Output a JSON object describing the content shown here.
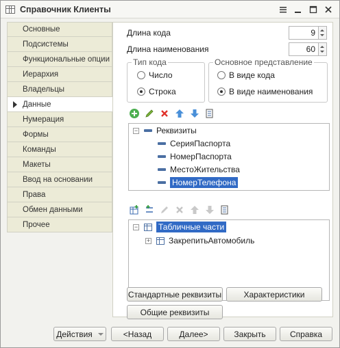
{
  "window": {
    "title": "Справочник Клиенты"
  },
  "sidebar": {
    "items": [
      {
        "label": "Основные"
      },
      {
        "label": "Подсистемы"
      },
      {
        "label": "Функциональные опции"
      },
      {
        "label": "Иерархия"
      },
      {
        "label": "Владельцы"
      },
      {
        "label": "Данные",
        "active": true
      },
      {
        "label": "Нумерация"
      },
      {
        "label": "Формы"
      },
      {
        "label": "Команды"
      },
      {
        "label": "Макеты"
      },
      {
        "label": "Ввод на основании"
      },
      {
        "label": "Права"
      },
      {
        "label": "Обмен данными"
      },
      {
        "label": "Прочее"
      }
    ]
  },
  "fields": {
    "code_length_label": "Длина кода",
    "code_length_value": "9",
    "name_length_label": "Длина наименования",
    "name_length_value": "60"
  },
  "code_type": {
    "title": "Тип кода",
    "options": [
      {
        "label": "Число",
        "checked": false
      },
      {
        "label": "Строка",
        "checked": true
      }
    ]
  },
  "main_repr": {
    "title": "Основное представление",
    "options": [
      {
        "label": "В виде кода",
        "checked": false
      },
      {
        "label": "В виде наименования",
        "checked": true
      }
    ]
  },
  "attributes_tree": {
    "root": "Реквизиты",
    "items": [
      "СерияПаспорта",
      "НомерПаспорта",
      "МестоЖительства",
      "НомерТелефона"
    ],
    "selected_index": 3
  },
  "tabular_tree": {
    "root": "Табличные части",
    "items": [
      "ЗакрепитьАвтомобиль"
    ]
  },
  "content_buttons": {
    "standard_attrs": "Стандартные реквизиты",
    "characteristics": "Характеристики",
    "common_attrs": "Общие реквизиты"
  },
  "footer": {
    "actions": "Действия",
    "back": "<Назад",
    "next": "Далее>",
    "close": "Закрыть",
    "help": "Справка"
  },
  "colors": {
    "accent": "#316ac5",
    "sidebar_bg": "#ecebd7"
  }
}
